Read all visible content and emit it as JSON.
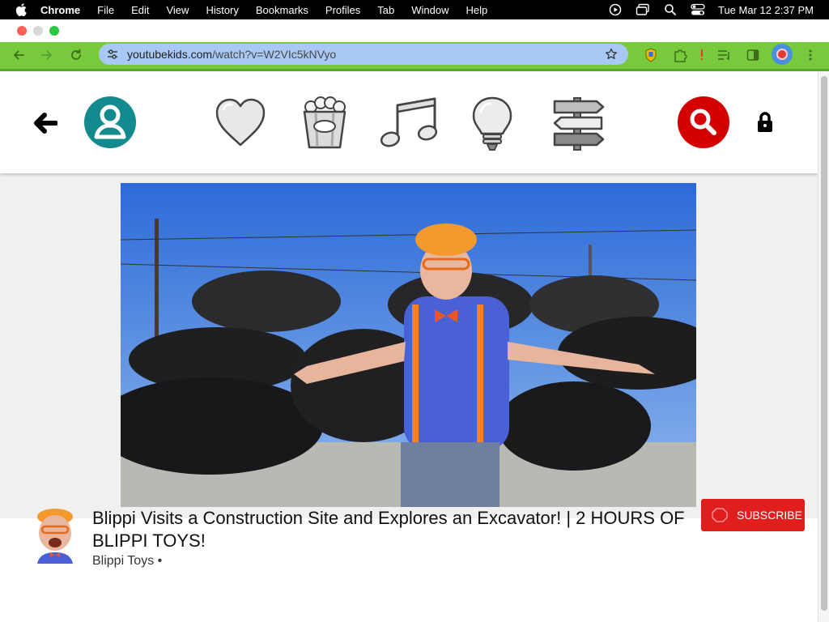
{
  "menubar": {
    "app_name": "Chrome",
    "items": [
      "File",
      "Edit",
      "View",
      "History",
      "Bookmarks",
      "Profiles",
      "Tab",
      "Window",
      "Help"
    ],
    "clock": "Tue Mar 12  2:37 PM",
    "status_icons": [
      "play-circle-icon",
      "screen-mirror-icon",
      "search-icon",
      "control-center-icon"
    ]
  },
  "browser": {
    "url_host": "youtubekids.com",
    "url_path": "/watch?v=W2VIc5kNVyo",
    "accent_color": "#78c93b",
    "omnibox_color": "#a8c8f5"
  },
  "kids_header": {
    "nav_icons": [
      "back-arrow-icon",
      "profile-icon",
      "heart-icon",
      "popcorn-icon",
      "music-note-icon",
      "lightbulb-icon",
      "signpost-icon",
      "search-icon",
      "lock-icon"
    ],
    "profile_color": "#138a8e",
    "search_color": "#d40000"
  },
  "video": {
    "title": "Blippi Visits a Construction Site and Explores an Excavator! | 2 HOURS OF BLIPPI TOYS!",
    "channel": "Blippi Toys •",
    "subscribe_label": "SUBSCRIBE",
    "subscribe_color": "#e01e1e"
  }
}
